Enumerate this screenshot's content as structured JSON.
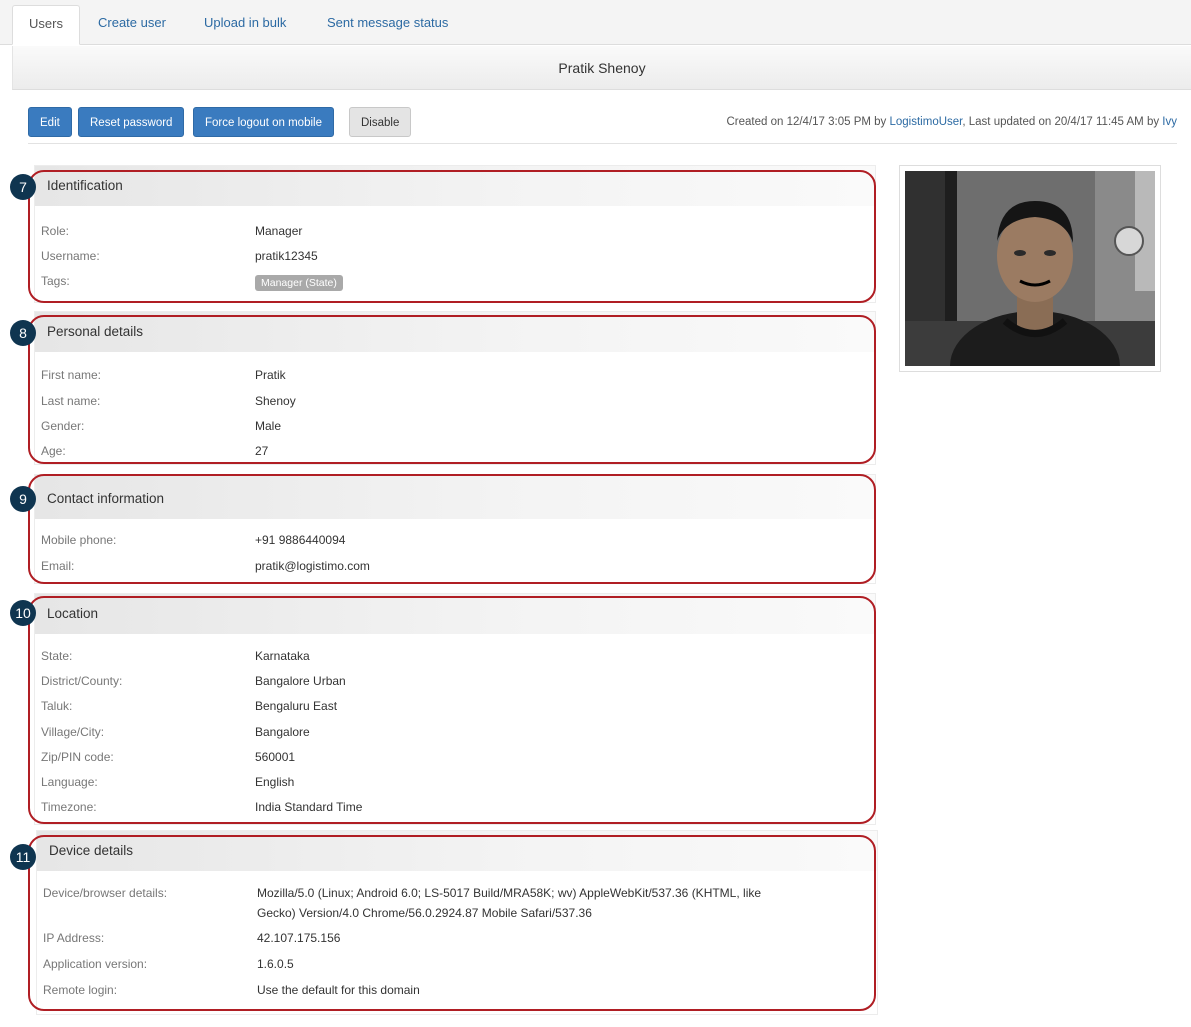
{
  "tabs": [
    "Users",
    "Create user",
    "Upload in bulk",
    "Sent message status"
  ],
  "header": {
    "title": "Pratik Shenoy"
  },
  "toolbar": {
    "edit": "Edit",
    "reset_password": "Reset password",
    "force_logout": "Force logout on mobile",
    "disable": "Disable"
  },
  "meta": {
    "created_prefix": "Created on 12/4/17 3:05 PM by ",
    "created_by": "LogistimoUser",
    "updated_prefix": ", Last updated on 20/4/17 11:45 AM by ",
    "updated_by": "Ivy"
  },
  "sections": {
    "identification": {
      "number": "7",
      "title": "Identification",
      "role_label": "Role:",
      "role": "Manager",
      "username_label": "Username:",
      "username": "pratik12345",
      "tags_label": "Tags:",
      "tag": "Manager (State)"
    },
    "personal": {
      "number": "8",
      "title": "Personal details",
      "first_label": "First name:",
      "first": "Pratik",
      "last_label": "Last name:",
      "last": "Shenoy",
      "gender_label": "Gender:",
      "gender": "Male",
      "age_label": "Age:",
      "age": "27"
    },
    "contact": {
      "number": "9",
      "title": "Contact information",
      "mobile_label": "Mobile phone:",
      "mobile": "+91 9886440094",
      "email_label": "Email:",
      "email": "pratik@logistimo.com"
    },
    "location": {
      "number": "10",
      "title": "Location",
      "state_label": "State:",
      "state": "Karnataka",
      "district_label": "District/County:",
      "district": "Bangalore Urban",
      "taluk_label": "Taluk:",
      "taluk": "Bengaluru East",
      "village_label": "Village/City:",
      "village": "Bangalore",
      "zip_label": "Zip/PIN code:",
      "zip": "560001",
      "language_label": "Language:",
      "language": "English",
      "timezone_label": "Timezone:",
      "timezone": "India Standard Time"
    },
    "device": {
      "number": "11",
      "title": "Device details",
      "browser_label": "Device/browser details:",
      "browser_line1": "Mozilla/5.0 (Linux; Android 6.0; LS-5017 Build/MRA58K; wv) AppleWebKit/537.36 (KHTML, like",
      "browser_line2": "Gecko) Version/4.0 Chrome/56.0.2924.87 Mobile Safari/537.36",
      "ip_label": "IP Address:",
      "ip": "42.107.175.156",
      "app_label": "Application version:",
      "app": "1.6.0.5",
      "remote_label": "Remote login:",
      "remote": "Use the default for this domain"
    }
  },
  "colors": {
    "accent": "#3a7bbf",
    "highlight_ring": "#b01e24",
    "badge": "#0f3550"
  }
}
